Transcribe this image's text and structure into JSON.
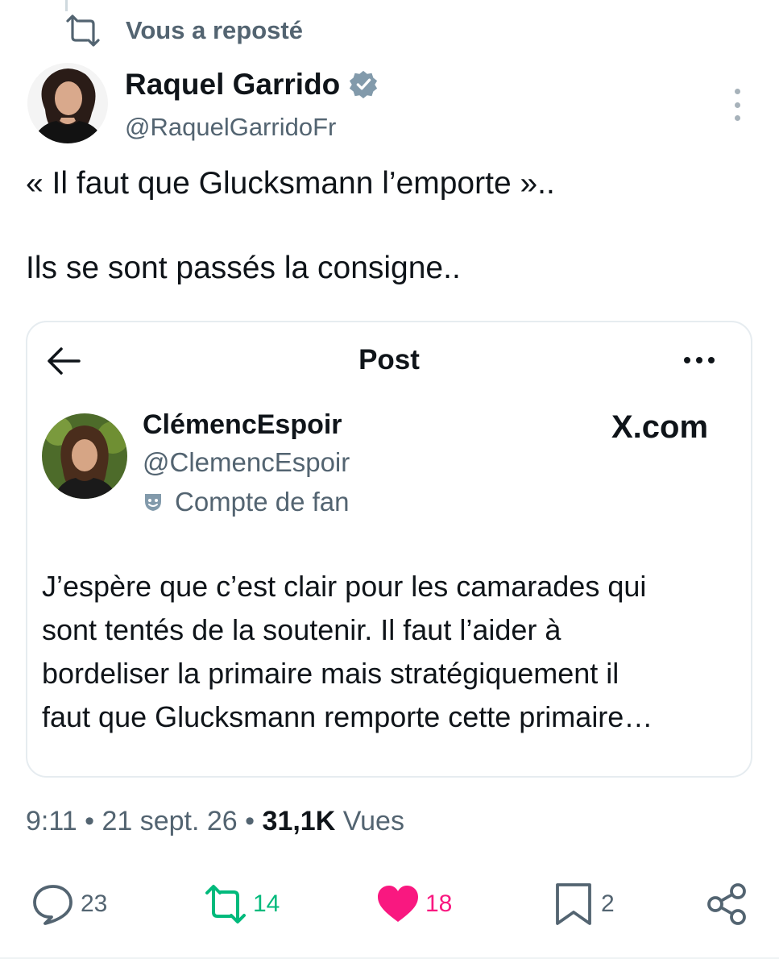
{
  "repost": {
    "label": "Vous a reposté"
  },
  "author": {
    "name": "Raquel Garrido",
    "handle": "@RaquelGarridoFr"
  },
  "tweet": {
    "lines": [
      "« Il faut que Glucksmann l’emporte »..",
      "Ils se sont passés la consigne.."
    ]
  },
  "quoted": {
    "header_title": "Post",
    "name": "ClémencEspoir",
    "handle": "@ClemencEspoir",
    "account_label": "Compte de fan",
    "brand": "X.com",
    "lines": [
      "J’espère que c’est clair pour les camarades qui",
      "sont tentés de la soutenir. Il faut l’aider à",
      "bordeliser la primaire mais stratégiquement il",
      "faut que Glucksmann remporte cette primaire…"
    ]
  },
  "meta": {
    "time": "9:11",
    "separator": "•",
    "date": "21 sept. 26",
    "views_count": "31,1K",
    "views_label": "Vues"
  },
  "actions": {
    "replies": "23",
    "reposts": "14",
    "likes": "18",
    "bookmarks": "2"
  },
  "colors": {
    "repost_green": "#00ba7c",
    "like_pink": "#f91880",
    "muted_gray": "#536471",
    "verified_gray": "#829aab"
  },
  "icons": [
    "repost-icon",
    "verified-badge-icon",
    "more-vertical-icon",
    "back-arrow-icon",
    "more-horizontal-icon",
    "fan-mask-icon",
    "reply-icon",
    "like-icon",
    "bookmark-icon",
    "share-icon"
  ]
}
